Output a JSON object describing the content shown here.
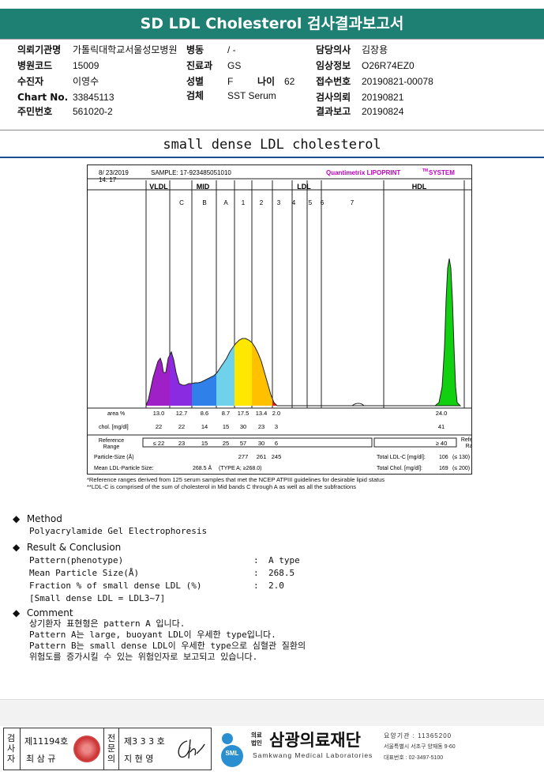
{
  "header": {
    "title": "SD LDL Cholesterol 검사결과보고서"
  },
  "patient": {
    "institution_label": "의뢰기관명",
    "institution": "가톨릭대학교서울성모병원",
    "ward_label": "병동",
    "ward": "/ -",
    "doctor_label": "담당의사",
    "doctor": "김장용",
    "hospital_code_label": "병원코드",
    "hospital_code": "15009",
    "dept_label": "진료과",
    "dept": "GS",
    "clinical_label": "임상정보",
    "clinical": "O26R74EZ0",
    "name_label": "수진자",
    "name": "이영수",
    "sex_label": "성별",
    "sex": "F",
    "age_label": "나이",
    "age": "62",
    "receipt_label": "접수번호",
    "receipt": "20190821-00078",
    "chart_label": "Chart No.",
    "chart": "33845113",
    "specimen_label": "검체",
    "specimen": "SST Serum",
    "request_label": "검사의뢰",
    "request": "20190821",
    "rrn_label": "주민번호",
    "rrn": "561020-2",
    "report_label": "결과보고",
    "report": "20190824"
  },
  "section_title": "small dense LDL cholesterol",
  "chart_data": {
    "type": "area",
    "date": "8/ 23/2019",
    "time": "14: 17",
    "sample": "SAMPLE:  17-923485051010",
    "brand": "Quantimetrix LIPOPRINT",
    "brand_tm": "TM",
    "brand_suffix": "SYSTEM",
    "groups": [
      "VLDL",
      "MID",
      "LDL",
      "HDL"
    ],
    "bands": [
      "C",
      "B",
      "A",
      "1",
      "2",
      "3",
      "4",
      "5",
      "6",
      "7"
    ],
    "colors": [
      "#a020c8",
      "#8a2be2",
      "#2f80e8",
      "#6fd2ea",
      "#ffe800",
      "#ffc000",
      "#e02020",
      "#10d010"
    ],
    "rows": {
      "area_label": "area %",
      "area": [
        "13.0",
        "12.7",
        "8.6",
        "8.7",
        "17.5",
        "13.4",
        "2.0",
        "24.0"
      ],
      "chol_label": "chol. [mg/dl]",
      "chol": [
        "22",
        "22",
        "14",
        "15",
        "30",
        "23",
        "3",
        "41"
      ],
      "ref_label": "Reference Range",
      "ref": [
        "≤ 22",
        "23",
        "15",
        "25",
        "57",
        "30",
        "6",
        "≥ 40"
      ],
      "ref_right": "Reference Range"
    },
    "particle_size_label": "Particle-Size (Å)",
    "particle_sizes": [
      "277",
      "261",
      "245"
    ],
    "mean_ldl_label": "Mean LDL-Particle Size:",
    "mean_ldl": "268.5 Å",
    "mean_ldl_type": "(TYPE A; ≥268.0)",
    "total_ldl_label": "Total LDL-C [mg/dl]:",
    "total_ldl": "106",
    "total_ldl_ref": "(≤ 130)",
    "total_chol_label": "Total Chol. [mg/dl]:",
    "total_chol": "169",
    "total_chol_ref": "(≤ 200)"
  },
  "footnotes": [
    "*Reference ranges derived from 125 serum samples that met the NCEP ATPIII guidelines for desirable lipid status",
    "**LDL-C is comprised of the sum of cholesterol in Mid bands C through A as well as all the subfractions"
  ],
  "method": {
    "title": "Method",
    "text": "Polyacrylamide Gel Electrophoresis"
  },
  "result": {
    "title": "Result & Conclusion",
    "pattern_label": "Pattern(phenotype)",
    "pattern": "A type",
    "mps_label": "Mean Particle Size(Å)",
    "mps": "268.5",
    "frac_label": "Fraction % of small dense LDL (%)",
    "frac": "2.0",
    "note": "[Small dense LDL = LDL3~7]",
    "colon": ":"
  },
  "comment": {
    "title": "Comment",
    "lines": [
      "상기환자 표현형은 pattern A 입니다.",
      "Pattern A는 large, buoyant LDL이 우세한 type입니다.",
      "Pattern B는 small dense LDL이 우세한 type으로 심혈관 질환의",
      "위험도를 증가시킬 수 있는 위험인자로 보고되고 있습니다."
    ]
  },
  "signature": {
    "tester_label": [
      "검",
      "사",
      "자"
    ],
    "tester_no": "제11194호",
    "tester_name": "최 삼 규",
    "specialist_label": [
      "전",
      "문",
      "의"
    ],
    "specialist_no": "제3 3 3 호",
    "specialist_name": "지 현 영"
  },
  "organization": {
    "badge_top": "의료",
    "badge_bottom": "법인",
    "name": "삼광의료재단",
    "english": "Samkwang Medical Laboratories",
    "logo": "SML",
    "institution_no": "요양기관 : 11365200",
    "address": "서울특별시 서초구 양재동 9-60",
    "phone": "대표번호 : 02-3497-5100"
  }
}
